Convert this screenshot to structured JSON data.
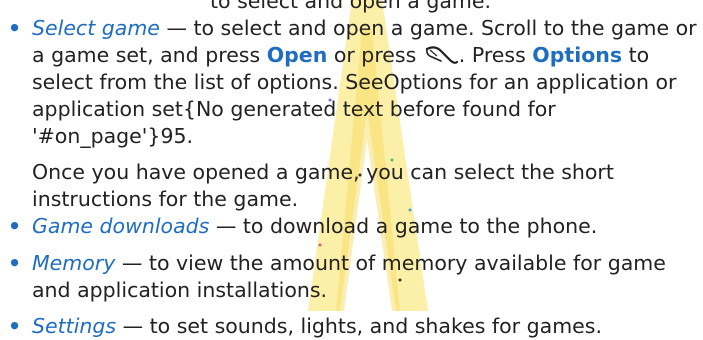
{
  "top_fragment": "to select and open a game.",
  "items": [
    {
      "term": "Select game",
      "dash": " —  to select and open a game. Scroll to the game or a game set, and press ",
      "key1": "Open",
      "mid1": " or press ",
      "mid2": ". Press ",
      "key2": "Options",
      "tail": " to select from the list of options. SeeOptions for an application or application set{No generated text before found for '#on_page'}95."
    },
    {
      "term": "Game downloads",
      "text": " — to download a game to the phone."
    },
    {
      "term": "Memory",
      "text": " — to view the amount of memory available for game and application installations."
    },
    {
      "term": "Settings",
      "text": " — to set sounds, lights, and shakes for games."
    }
  ],
  "note": "Once you have opened a game, you can select the short instructions for the game.",
  "icons": {
    "call_key": "call-key-icon"
  },
  "colors": {
    "accent": "#1f6dc0",
    "text": "#222222",
    "watermark": "#f6d95a"
  }
}
